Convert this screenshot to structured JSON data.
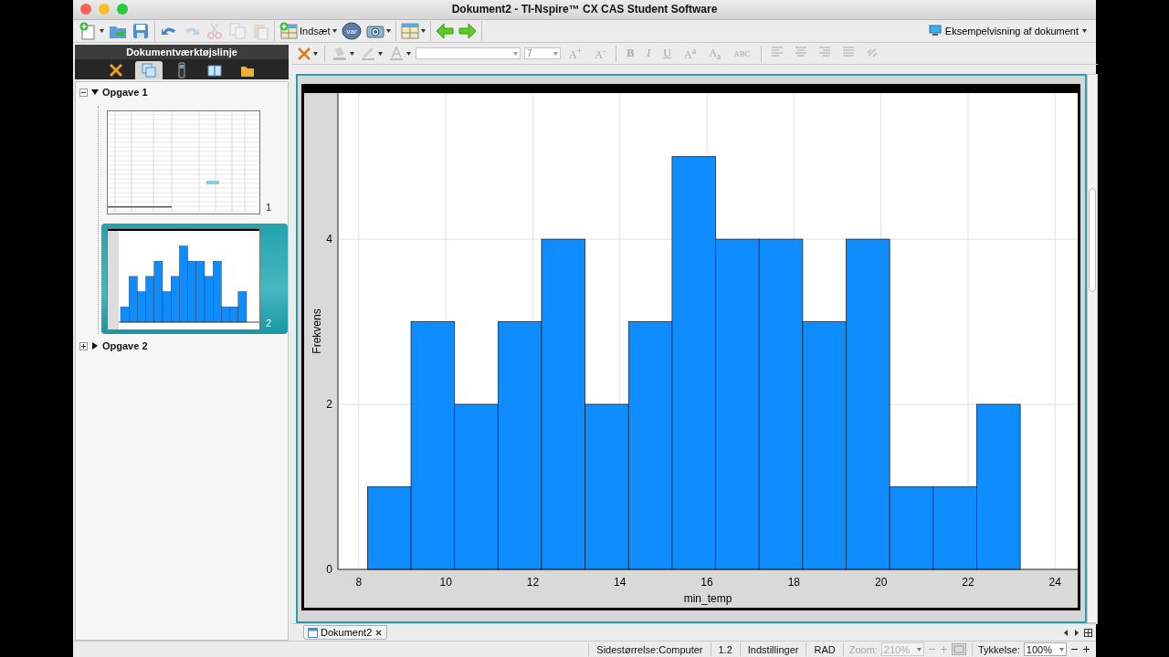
{
  "window": {
    "title": "Dokument2 - TI-Nspire™ CX CAS Student Software"
  },
  "toolbar": {
    "groups": [
      [
        {
          "kind": "new",
          "disabled": false,
          "menu": true
        },
        {
          "kind": "open",
          "disabled": false
        },
        {
          "kind": "save",
          "disabled": false
        }
      ],
      [
        {
          "kind": "undo",
          "disabled": false
        },
        {
          "kind": "redo",
          "disabled": true
        },
        {
          "kind": "cut",
          "disabled": true
        },
        {
          "kind": "copy",
          "disabled": true
        },
        {
          "kind": "paste",
          "disabled": true
        }
      ],
      [
        {
          "kind": "insert",
          "label": "Indsæt",
          "disabled": false,
          "menu": true
        },
        {
          "kind": "var",
          "label": "var",
          "disabled": false
        },
        {
          "kind": "camera",
          "disabled": false,
          "menu": true
        }
      ],
      [
        {
          "kind": "layout",
          "disabled": false,
          "menu": true
        }
      ],
      [
        {
          "kind": "back",
          "disabled": false
        },
        {
          "kind": "forward",
          "disabled": false
        }
      ]
    ],
    "preview_button": "Eksempelvisning af dokument"
  },
  "sidebar": {
    "title": "Dokumentværktøjslinje",
    "tabs": [
      {
        "kind": "tools",
        "selected": false
      },
      {
        "kind": "sorter",
        "selected": true
      },
      {
        "kind": "handheld",
        "selected": false
      },
      {
        "kind": "book",
        "selected": false
      },
      {
        "kind": "folder",
        "selected": false
      }
    ],
    "problems": [
      {
        "label": "Opgave 1",
        "expanded": true,
        "pages": [
          {
            "number": "1",
            "kind": "spreadsheet",
            "selected": false
          },
          {
            "number": "2",
            "kind": "histogram",
            "selected": true
          }
        ]
      },
      {
        "label": "Opgave 2",
        "expanded": false
      }
    ]
  },
  "format_toolbar": {
    "font_size": "7",
    "buttons": [
      {
        "label": "A$^{+}$"
      },
      {
        "label": "A$^{-}$"
      },
      {
        "label": "B"
      },
      {
        "label": "I"
      },
      {
        "label": "U"
      },
      {
        "label": "A$^{a}$"
      },
      {
        "label": "A$_{a}$"
      },
      {
        "label": "ABC"
      }
    ]
  },
  "document": {
    "chart_data": {
      "type": "bar",
      "xlabel": "min_temp",
      "ylabel": "Frekvens",
      "x": [
        8.7,
        9.7,
        10.7,
        11.7,
        12.7,
        13.7,
        14.7,
        15.7,
        16.7,
        17.7,
        18.7,
        19.7,
        20.7,
        21.7,
        22.7
      ],
      "series": [
        {
          "color": "#0f8cff",
          "values": [
            1,
            3,
            2,
            3,
            4,
            2,
            3,
            5,
            4,
            4,
            3,
            4,
            1,
            1,
            2
          ]
        }
      ],
      "grid": true,
      "xlim": [
        7.52,
        24.52
      ],
      "ylim": [
        0,
        5.77
      ],
      "xticks": [
        8,
        10,
        12,
        14,
        16,
        18,
        20,
        22,
        24
      ],
      "yticks": [
        0,
        2,
        4
      ]
    }
  },
  "doc_tabs": [
    {
      "label": "Dokument2",
      "selected": true
    }
  ],
  "status_bar": {
    "page_size": "Sidestørrelse:Computer",
    "page_number": "1.2",
    "settings": "Indstillinger",
    "angle_mode": "RAD",
    "zoom": {
      "label": "Zoom:",
      "value": "210%",
      "disabled": true
    },
    "thickness": {
      "label": "Tykkelse:",
      "value": "100%"
    }
  }
}
